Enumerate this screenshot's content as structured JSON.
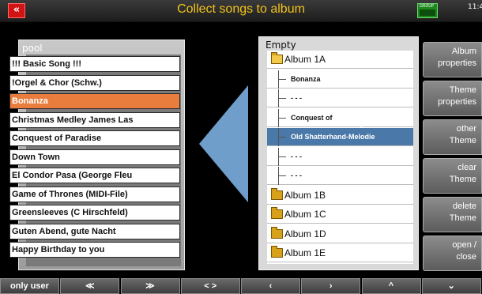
{
  "header": {
    "back_label": "«",
    "title": "Collect songs to album",
    "keyboard_label": "GROUP",
    "clock": "11:4"
  },
  "pool": {
    "title": "pool",
    "items": [
      "!!! Basic Song !!!",
      "!Orgel & Chor (Schw.)",
      "Bonanza",
      "Christmas Medley James Las",
      "Conquest of Paradise",
      "Down Town",
      "El Condor Pasa (George Fleu",
      "Game of Thrones (MIDI-File)",
      "Greensleeves (C Hirschfeld)",
      "Guten Abend, gute Nacht",
      "Happy Birthday to you"
    ],
    "selected_index": 2
  },
  "album": {
    "title": "Empty",
    "items": [
      {
        "type": "album-open",
        "label": "Album 1A"
      },
      {
        "type": "song",
        "label": "Bonanza"
      },
      {
        "type": "song",
        "label": "- - -"
      },
      {
        "type": "song",
        "label": "Conquest of"
      },
      {
        "type": "song",
        "label": "Old Shatterhand-Melodie",
        "highlight": true
      },
      {
        "type": "song",
        "label": "- - -"
      },
      {
        "type": "song",
        "label": "- - -"
      },
      {
        "type": "album",
        "label": "Album 1B"
      },
      {
        "type": "album",
        "label": "Album 1C"
      },
      {
        "type": "album",
        "label": "Album 1D"
      },
      {
        "type": "album",
        "label": "Album 1E"
      }
    ]
  },
  "side_buttons": [
    [
      "Album",
      "properties"
    ],
    [
      "Theme",
      "properties"
    ],
    [
      "other",
      "Theme"
    ],
    [
      "clear",
      "Theme"
    ],
    [
      "delete",
      "Theme"
    ],
    [
      "open  /",
      "close"
    ]
  ],
  "bottom_buttons": [
    "only user",
    "≪",
    "≫",
    "< >",
    "‹",
    "›",
    "^",
    "⌄"
  ],
  "colors": {
    "title": "#f2c21a",
    "selected": "#e87d3e",
    "highlight": "#4a78a8",
    "arrow": "#6e9ec9"
  }
}
